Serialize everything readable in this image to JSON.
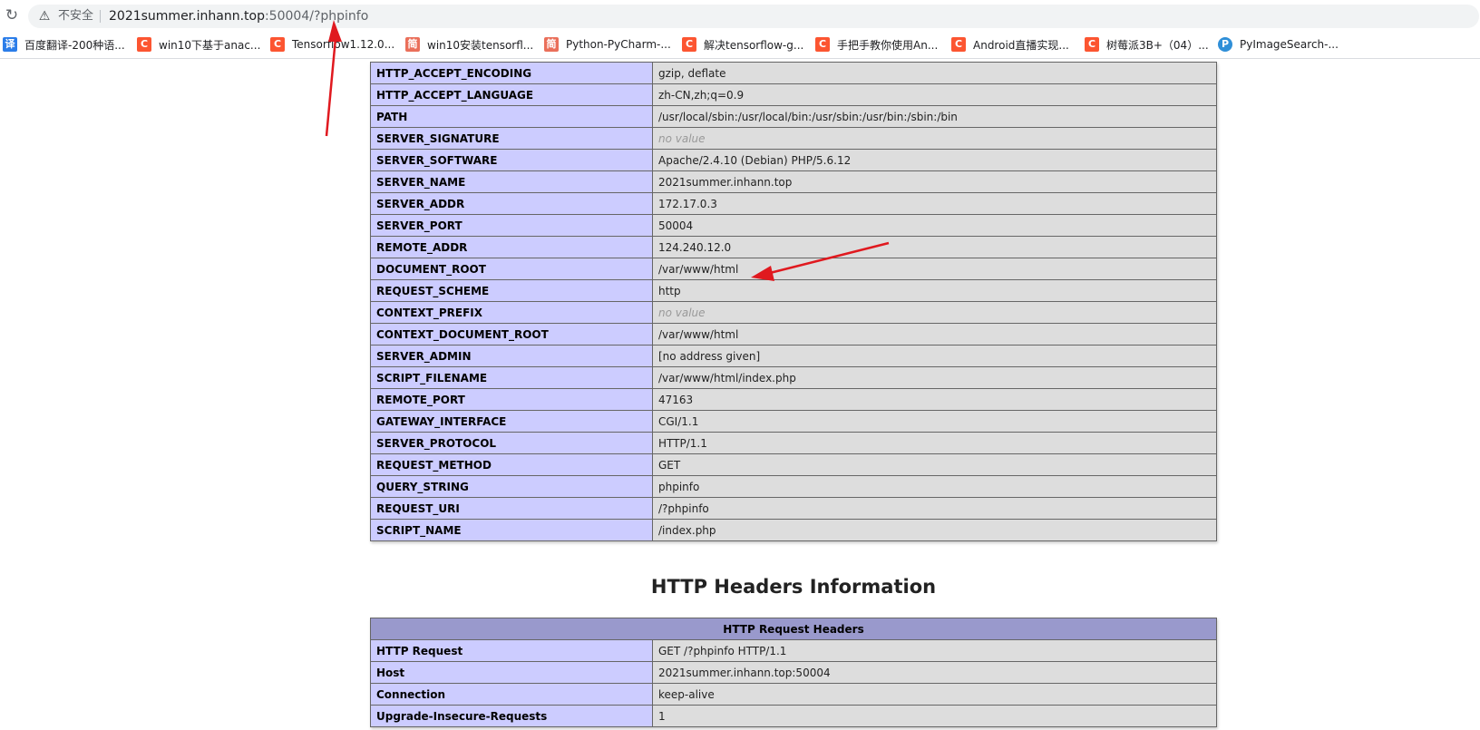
{
  "browser": {
    "reload_icon": "reload-icon",
    "security_label": "不安全",
    "url_host": "2021summer.inhann.top",
    "url_path": ":50004/?phpinfo"
  },
  "bookmarks": [
    {
      "icon": "译",
      "label": "百度翻译-200种语..."
    },
    {
      "icon": "C",
      "label": "win10下基于anac..."
    },
    {
      "icon": "C",
      "label": "Tensorflow1.12.0..."
    },
    {
      "icon": "简",
      "label": "win10安装tensorfl..."
    },
    {
      "icon": "简",
      "label": "Python-PyCharm-..."
    },
    {
      "icon": "C",
      "label": "解决tensorflow-g..."
    },
    {
      "icon": "C",
      "label": "手把手教你使用An..."
    },
    {
      "icon": "C",
      "label": "Android直播实现..."
    },
    {
      "icon": "C",
      "label": "树莓派3B+（04）..."
    },
    {
      "icon": "P",
      "label": "PyImageSearch-..."
    }
  ],
  "env_table": {
    "rows": [
      {
        "key": "HTTP_ACCEPT_ENCODING",
        "value": "gzip, deflate"
      },
      {
        "key": "HTTP_ACCEPT_LANGUAGE",
        "value": "zh-CN,zh;q=0.9"
      },
      {
        "key": "PATH",
        "value": "/usr/local/sbin:/usr/local/bin:/usr/sbin:/usr/bin:/sbin:/bin"
      },
      {
        "key": "SERVER_SIGNATURE",
        "value": "no value"
      },
      {
        "key": "SERVER_SOFTWARE",
        "value": "Apache/2.4.10 (Debian) PHP/5.6.12"
      },
      {
        "key": "SERVER_NAME",
        "value": "2021summer.inhann.top"
      },
      {
        "key": "SERVER_ADDR",
        "value": "172.17.0.3"
      },
      {
        "key": "SERVER_PORT",
        "value": "50004"
      },
      {
        "key": "REMOTE_ADDR",
        "value": "124.240.12.0"
      },
      {
        "key": "DOCUMENT_ROOT",
        "value": "/var/www/html"
      },
      {
        "key": "REQUEST_SCHEME",
        "value": "http"
      },
      {
        "key": "CONTEXT_PREFIX",
        "value": "no value"
      },
      {
        "key": "CONTEXT_DOCUMENT_ROOT",
        "value": "/var/www/html"
      },
      {
        "key": "SERVER_ADMIN",
        "value": "[no address given]"
      },
      {
        "key": "SCRIPT_FILENAME",
        "value": "/var/www/html/index.php"
      },
      {
        "key": "REMOTE_PORT",
        "value": "47163"
      },
      {
        "key": "GATEWAY_INTERFACE",
        "value": "CGI/1.1"
      },
      {
        "key": "SERVER_PROTOCOL",
        "value": "HTTP/1.1"
      },
      {
        "key": "REQUEST_METHOD",
        "value": "GET"
      },
      {
        "key": "QUERY_STRING",
        "value": "phpinfo"
      },
      {
        "key": "REQUEST_URI",
        "value": "/?phpinfo"
      },
      {
        "key": "SCRIPT_NAME",
        "value": "/index.php"
      }
    ]
  },
  "headers_section": {
    "title": "HTTP Headers Information",
    "table_header": "HTTP Request Headers",
    "rows": [
      {
        "key": "HTTP Request",
        "value": "GET /?phpinfo HTTP/1.1"
      },
      {
        "key": "Host",
        "value": "2021summer.inhann.top:50004"
      },
      {
        "key": "Connection",
        "value": "keep-alive"
      },
      {
        "key": "Upgrade-Insecure-Requests",
        "value": "1"
      }
    ]
  },
  "colors": {
    "key_cell": "#ccccff",
    "value_cell": "#dddddd",
    "header_cell": "#9999cc",
    "annotation_arrow": "#e0191f"
  }
}
